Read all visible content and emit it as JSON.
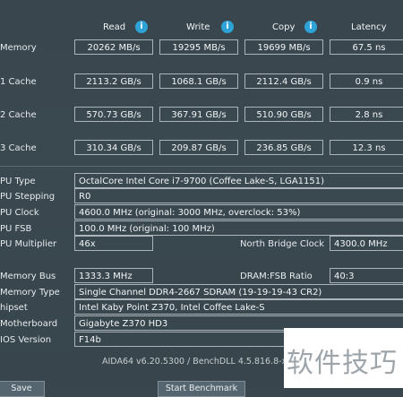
{
  "headers": {
    "read": "Read",
    "write": "Write",
    "copy": "Copy",
    "latency": "Latency"
  },
  "info_icon_glyph": "i",
  "bench_rows": [
    {
      "label": "Memory",
      "read": "20262 MB/s",
      "write": "19295 MB/s",
      "copy": "19699 MB/s",
      "latency": "67.5 ns"
    },
    {
      "label": "1 Cache",
      "read": "2113.2 GB/s",
      "write": "1068.1 GB/s",
      "copy": "2112.4 GB/s",
      "latency": "0.9 ns"
    },
    {
      "label": "2 Cache",
      "read": "570.73 GB/s",
      "write": "367.91 GB/s",
      "copy": "510.90 GB/s",
      "latency": "2.8 ns"
    },
    {
      "label": "3 Cache",
      "read": "310.34 GB/s",
      "write": "209.87 GB/s",
      "copy": "236.85 GB/s",
      "latency": "12.3 ns"
    }
  ],
  "info": {
    "cpu_type": {
      "label": "PU Type",
      "value": "OctalCore Intel Core i7-9700  (Coffee Lake-S, LGA1151)"
    },
    "cpu_stepping": {
      "label": "PU Stepping",
      "value": "R0"
    },
    "cpu_clock": {
      "label": "PU Clock",
      "value": "4600.0 MHz  (original: 3000 MHz, overclock: 53%)"
    },
    "cpu_fsb": {
      "label": "PU FSB",
      "value": "100.0 MHz  (original: 100 MHz)"
    },
    "cpu_multiplier": {
      "label": "PU Multiplier",
      "value": "46x"
    },
    "nb_clock": {
      "label": "North Bridge Clock",
      "value": "4300.0 MHz"
    },
    "memory_bus": {
      "label": "Memory Bus",
      "value": "1333.3 MHz"
    },
    "dram_fsb": {
      "label": "DRAM:FSB Ratio",
      "value": "40:3"
    },
    "memory_type": {
      "label": "Memory Type",
      "value": "Single Channel DDR4-2667 SDRAM  (19-19-19-43 CR2)"
    },
    "chipset": {
      "label": "hipset",
      "value": "Intel Kaby Point Z370, Intel Coffee Lake-S"
    },
    "motherboard": {
      "label": "Motherboard",
      "value": "Gigabyte Z370 HD3"
    },
    "bios": {
      "label": "IOS Version",
      "value": "F14b"
    }
  },
  "footer": "AIDA64 v6.20.5300 / BenchDLL 4.5.816.8-x6",
  "buttons": {
    "save": "Save",
    "start": "Start Benchmark"
  },
  "watermark": "软件技巧"
}
